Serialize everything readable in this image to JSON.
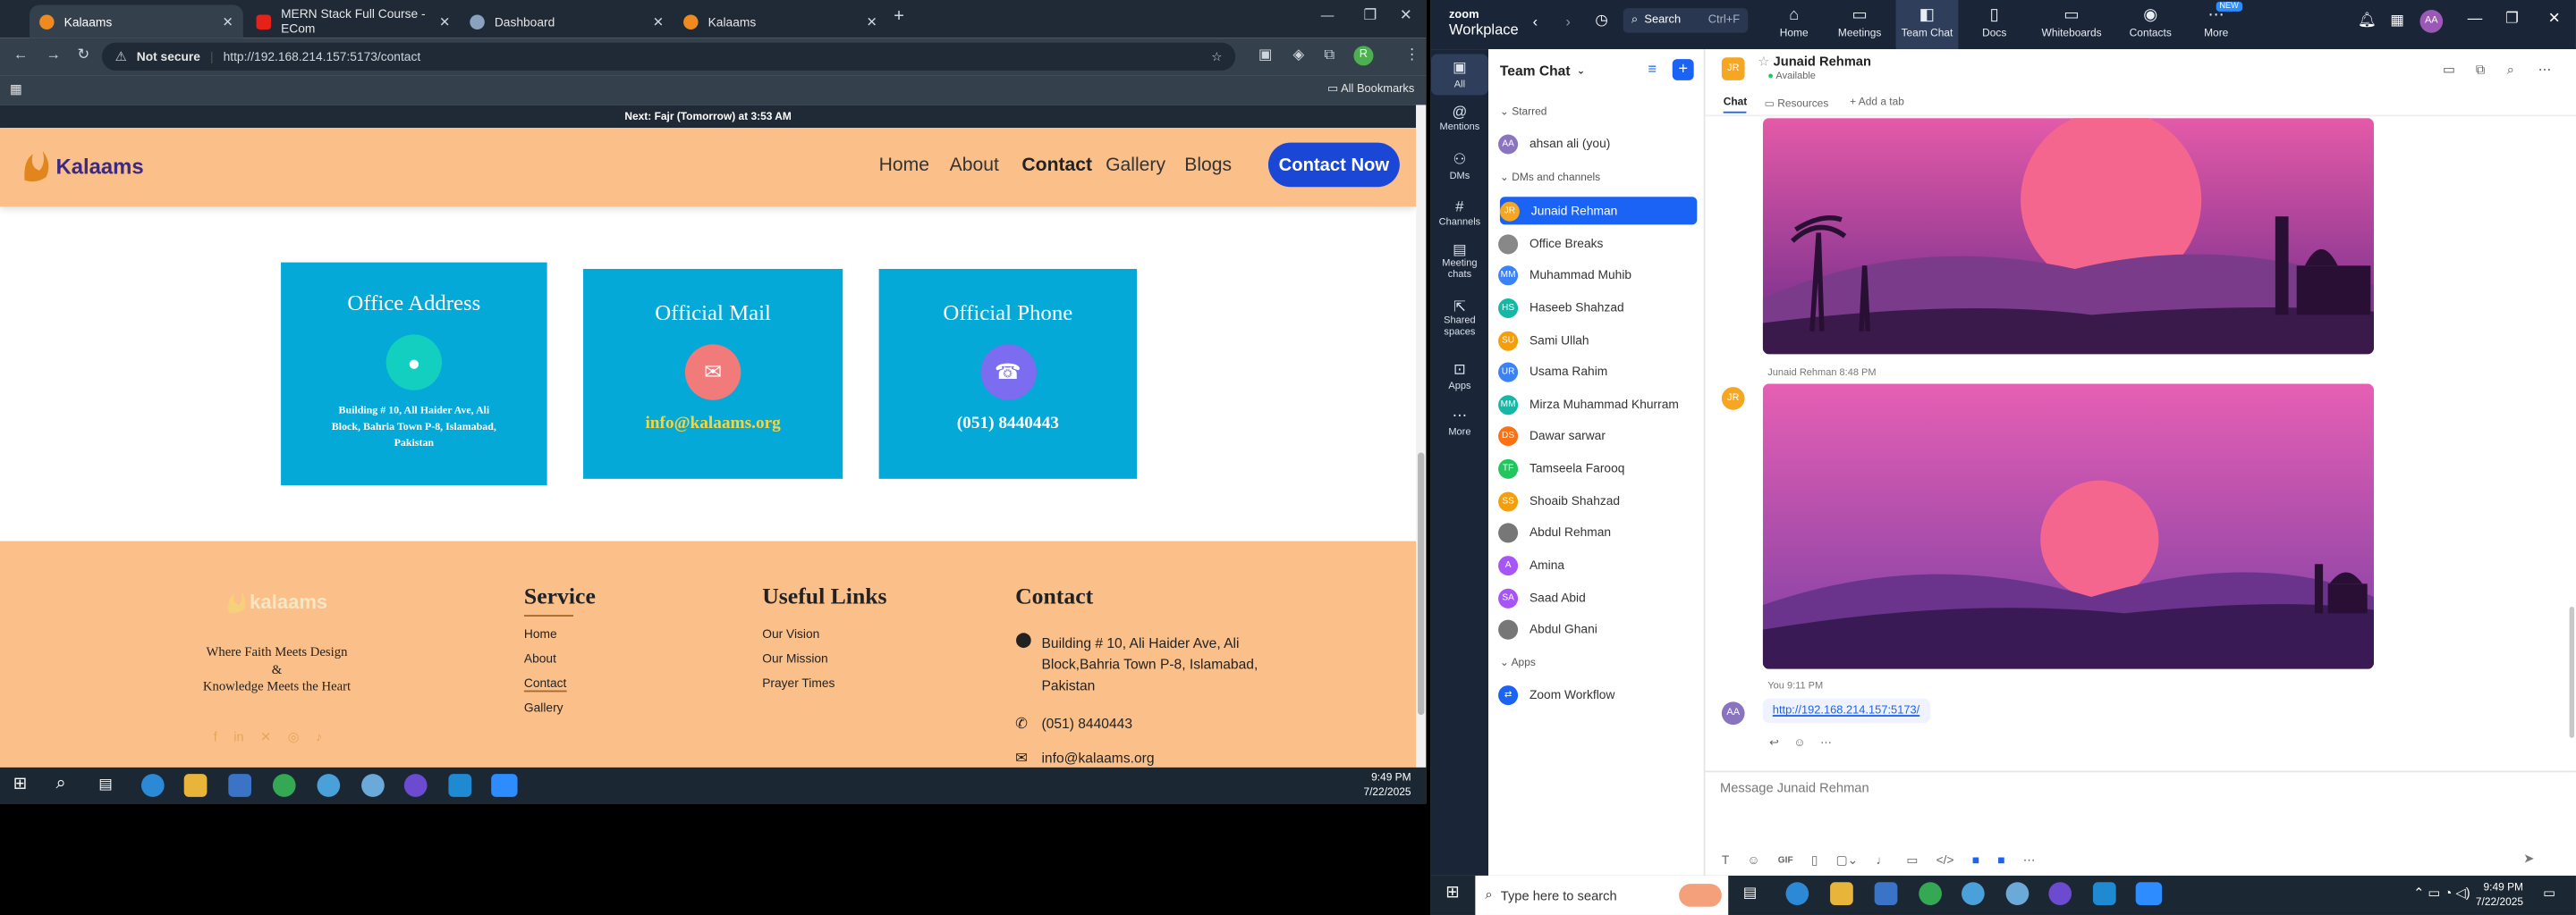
{
  "browser": {
    "tabs": [
      {
        "label": "Kalaams",
        "active": true
      },
      {
        "label": "MERN Stack Full Course - ECom",
        "active": false
      },
      {
        "label": "Dashboard",
        "active": false
      },
      {
        "label": "Kalaams",
        "active": false
      }
    ],
    "security": "Not secure",
    "url": "http://192.168.214.157:5173/contact",
    "bookmarks_label": "All Bookmarks"
  },
  "site": {
    "prayer_bar": "Next: Fajr (Tomorrow) at 3:53 AM",
    "logo_text": "Kalaams",
    "nav": [
      "Home",
      "About",
      "Contact",
      "Gallery",
      "Blogs"
    ],
    "cta": "Contact Now",
    "cards": [
      {
        "title": "Office Address",
        "icon": "globe-icon",
        "text": "Building # 10, All Haider Ave, Ali Block, Bahria Town P-8, Islamabad, Pakistan"
      },
      {
        "title": "Official Mail",
        "icon": "mail-icon",
        "text": "info@kalaams.org"
      },
      {
        "title": "Official Phone",
        "icon": "headset-icon",
        "text": "(051) 8440443"
      }
    ],
    "footer": {
      "logo_text": "kalaams",
      "tagline_1": "Where Faith Meets Design",
      "tagline_2": "&",
      "tagline_3": "Knowledge Meets the Heart",
      "service_title": "Service",
      "service_links": [
        "Home",
        "About",
        "Contact",
        "Gallery"
      ],
      "useful_title": "Useful Links",
      "useful_links": [
        "Our Vision",
        "Our Mission",
        "Prayer Times"
      ],
      "contact_title": "Contact",
      "contact_address": "Building # 10, Ali Haider Ave, Ali Block,Bahria Town P-8, Islamabad, Pakistan",
      "contact_phone": "(051) 8440443",
      "contact_email": "info@kalaams.org"
    }
  },
  "taskbar_left": {
    "time": "9:49 PM",
    "date": "7/22/2025"
  },
  "zoom": {
    "brand_top": "zoom",
    "brand_bottom": "Workplace",
    "search": "Search",
    "search_shortcut": "Ctrl+F",
    "nav": [
      {
        "label": "Home",
        "icon": "home-icon"
      },
      {
        "label": "Meetings",
        "icon": "video-icon"
      },
      {
        "label": "Team Chat",
        "icon": "chat-icon"
      },
      {
        "label": "Docs",
        "icon": "doc-icon"
      },
      {
        "label": "Whiteboards",
        "icon": "whiteboard-icon"
      },
      {
        "label": "Contacts",
        "icon": "contacts-icon"
      },
      {
        "label": "More",
        "icon": "more-icon"
      }
    ],
    "more_badge": "NEW",
    "profile_initials": "AA",
    "rail": [
      "All",
      "Mentions",
      "DMs",
      "Channels",
      "Meeting chats",
      "Shared spaces",
      "Apps",
      "More"
    ],
    "list_title": "Team Chat",
    "starred": "Starred",
    "self": {
      "initials": "AA",
      "name": "ahsan ali (you)"
    },
    "dms_title": "DMs and channels",
    "contacts": [
      {
        "initials": "JR",
        "name": "Junaid Rehman",
        "color": "#f5a623"
      },
      {
        "initials": "",
        "name": "Office Breaks",
        "color": "#888888"
      },
      {
        "initials": "MM",
        "name": "Muhammad Muhib",
        "color": "#3b82f6"
      },
      {
        "initials": "HS",
        "name": "Haseeb Shahzad",
        "color": "#14b8a6"
      },
      {
        "initials": "SU",
        "name": "Sami Ullah",
        "color": "#f59e0b"
      },
      {
        "initials": "UR",
        "name": "Usama Rahim",
        "color": "#3b82f6"
      },
      {
        "initials": "MM",
        "name": "Mirza Muhammad Khurram",
        "color": "#14b8a6"
      },
      {
        "initials": "DS",
        "name": "Dawar sarwar",
        "color": "#f97316"
      },
      {
        "initials": "TF",
        "name": "Tamseela Farooq",
        "color": "#22c55e"
      },
      {
        "initials": "SS",
        "name": "Shoaib Shahzad",
        "color": "#f59e0b"
      },
      {
        "initials": "",
        "name": "Abdul Rehman",
        "color": "#777777"
      },
      {
        "initials": "A",
        "name": "Amina",
        "color": "#a855f7"
      },
      {
        "initials": "SA",
        "name": "Saad Abid",
        "color": "#a855f7"
      },
      {
        "initials": "",
        "name": "Abdul Ghani",
        "color": "#777777"
      }
    ],
    "apps_title": "Apps",
    "app_item": "Zoom Workflow",
    "chat_header": {
      "initials": "JR",
      "name": "Junaid Rehman",
      "status": "Available"
    },
    "chat_tabs": [
      "Chat",
      "Resources",
      "Add a tab"
    ],
    "msg1_meta": "Junaid Rehman 8:48 PM",
    "msg2_meta": "You 9:11 PM",
    "msg2_initials": "AA",
    "msg2_link": "http://192.168.214.157:5173/",
    "composer_placeholder": "Message Junaid Rehman"
  },
  "taskbar_right": {
    "search_placeholder": "Type here to search",
    "time": "9:49 PM",
    "date": "7/22/2025"
  }
}
